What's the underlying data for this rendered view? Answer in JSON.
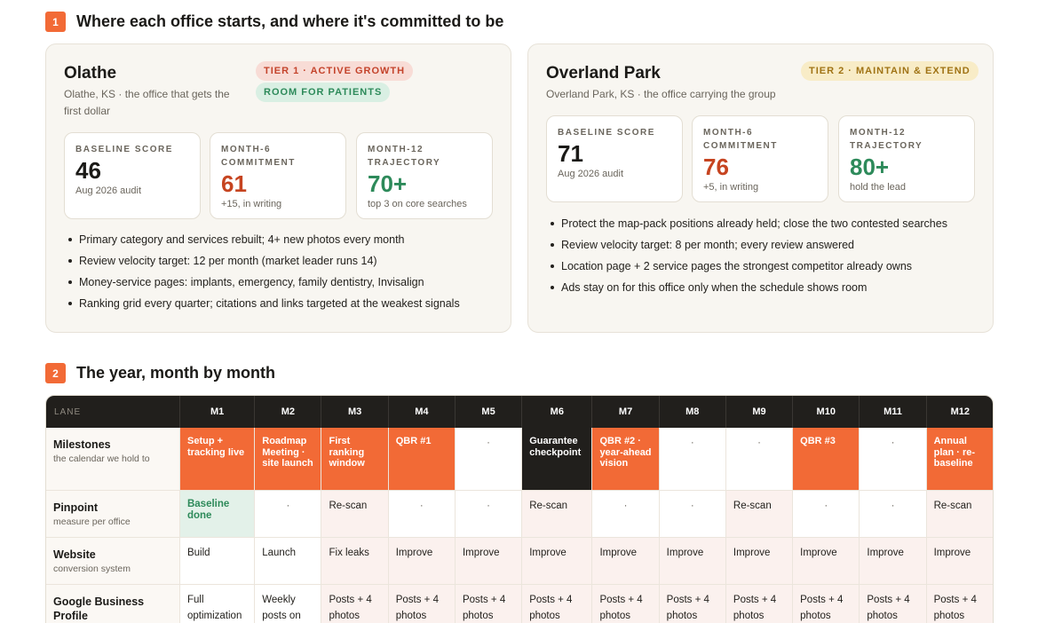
{
  "sections": [
    {
      "num": "1",
      "title": "Where each office starts, and where it's committed to be"
    },
    {
      "num": "2",
      "title": "The year, month by month"
    }
  ],
  "offices": [
    {
      "name": "Olathe",
      "subtitle": "Olathe, KS · the office that gets the first dollar",
      "pills": [
        {
          "label": "TIER 1 · ACTIVE GROWTH",
          "color": "red"
        },
        {
          "label": "ROOM FOR PATIENTS",
          "color": "green"
        }
      ],
      "metrics": [
        {
          "label": "BASELINE SCORE",
          "value": "46",
          "note": "Aug 2026 audit",
          "tone": "dark"
        },
        {
          "label": "MONTH-6 COMMITMENT",
          "value": "61",
          "note": "+15, in writing",
          "tone": "orange"
        },
        {
          "label": "MONTH-12 TRAJECTORY",
          "value": "70+",
          "note": "top 3 on core searches",
          "tone": "green"
        }
      ],
      "bullets": [
        "Primary category and services rebuilt; 4+ new photos every month",
        "Review velocity target: 12 per month (market leader runs 14)",
        "Money-service pages: implants, emergency, family dentistry, Invisalign",
        "Ranking grid every quarter; citations and links targeted at the weakest signals"
      ]
    },
    {
      "name": "Overland Park",
      "subtitle": "Overland Park, KS · the office carrying the group",
      "pills": [
        {
          "label": "TIER 2 · MAINTAIN & EXTEND",
          "color": "gold"
        }
      ],
      "metrics": [
        {
          "label": "BASELINE SCORE",
          "value": "71",
          "note": "Aug 2026 audit",
          "tone": "dark"
        },
        {
          "label": "MONTH-6 COMMITMENT",
          "value": "76",
          "note": "+5, in writing",
          "tone": "orange"
        },
        {
          "label": "MONTH-12 TRAJECTORY",
          "value": "80+",
          "note": "hold the lead",
          "tone": "green"
        }
      ],
      "bullets": [
        "Protect the map-pack positions already held; close the two contested searches",
        "Review velocity target: 8 per month; every review answered",
        "Location page + 2 service pages the strongest competitor already owns",
        "Ads stay on for this office only when the schedule shows room"
      ]
    }
  ],
  "timeline": {
    "lane_header": "LANE",
    "months": [
      "M1",
      "M2",
      "M3",
      "M4",
      "M5",
      "M6",
      "M7",
      "M8",
      "M9",
      "M10",
      "M11",
      "M12"
    ],
    "lanes": [
      {
        "title": "Milestones",
        "sub": "the calendar we hold to",
        "cells": [
          {
            "text": "Setup + tracking live",
            "style": "orange"
          },
          {
            "text": "Roadmap Meeting · site launch",
            "style": "orange"
          },
          {
            "text": "First ranking window",
            "style": "orange"
          },
          {
            "text": "QBR #1",
            "style": "orange"
          },
          {
            "text": "·",
            "style": "dot"
          },
          {
            "text": "Guarantee checkpoint",
            "style": "black"
          },
          {
            "text": "QBR #2 · year-ahead vision",
            "style": "orange"
          },
          {
            "text": "·",
            "style": "dot"
          },
          {
            "text": "·",
            "style": "dot"
          },
          {
            "text": "QBR #3",
            "style": "orange"
          },
          {
            "text": "·",
            "style": "dot"
          },
          {
            "text": "Annual plan · re-baseline",
            "style": "orange"
          }
        ]
      },
      {
        "title": "Pinpoint",
        "sub": "measure per office",
        "cells": [
          {
            "text": "Baseline done",
            "style": "green"
          },
          {
            "text": "·",
            "style": "dot"
          },
          {
            "text": "Re-scan",
            "style": "tint"
          },
          {
            "text": "·",
            "style": "dot"
          },
          {
            "text": "·",
            "style": "dot"
          },
          {
            "text": "Re-scan",
            "style": "tint"
          },
          {
            "text": "·",
            "style": "dot"
          },
          {
            "text": "·",
            "style": "dot"
          },
          {
            "text": "Re-scan",
            "style": "tint"
          },
          {
            "text": "·",
            "style": "dot"
          },
          {
            "text": "·",
            "style": "dot"
          },
          {
            "text": "Re-scan",
            "style": "tint"
          }
        ]
      },
      {
        "title": "Website",
        "sub": "conversion system",
        "cells": [
          {
            "text": "Build",
            "style": "white"
          },
          {
            "text": "Launch",
            "style": "white"
          },
          {
            "text": "Fix leaks",
            "style": "tint"
          },
          {
            "text": "Improve",
            "style": "tint"
          },
          {
            "text": "Improve",
            "style": "tint"
          },
          {
            "text": "Improve",
            "style": "tint"
          },
          {
            "text": "Improve",
            "style": "tint"
          },
          {
            "text": "Improve",
            "style": "tint"
          },
          {
            "text": "Improve",
            "style": "tint"
          },
          {
            "text": "Improve",
            "style": "tint"
          },
          {
            "text": "Improve",
            "style": "tint"
          },
          {
            "text": "Improve",
            "style": "tint"
          }
        ]
      },
      {
        "title": "Google Business Profile",
        "sub": "",
        "cells": [
          {
            "text": "Full optimization",
            "style": "white"
          },
          {
            "text": "Weekly posts on",
            "style": "white"
          },
          {
            "text": "Posts + 4 photos",
            "style": "tint"
          },
          {
            "text": "Posts + 4 photos",
            "style": "tint"
          },
          {
            "text": "Posts + 4 photos",
            "style": "tint"
          },
          {
            "text": "Posts + 4 photos",
            "style": "tint"
          },
          {
            "text": "Posts + 4 photos",
            "style": "tint"
          },
          {
            "text": "Posts + 4 photos",
            "style": "tint"
          },
          {
            "text": "Posts + 4 photos",
            "style": "tint"
          },
          {
            "text": "Posts + 4 photos",
            "style": "tint"
          },
          {
            "text": "Posts + 4 photos",
            "style": "tint"
          },
          {
            "text": "Posts + 4 photos",
            "style": "tint"
          }
        ]
      }
    ]
  },
  "colors": {
    "accent": "#f26a36",
    "dark": "#211f1c",
    "green": "#2d8a5a",
    "orange_value": "#c64420",
    "card_bg": "#f8f6f1"
  }
}
